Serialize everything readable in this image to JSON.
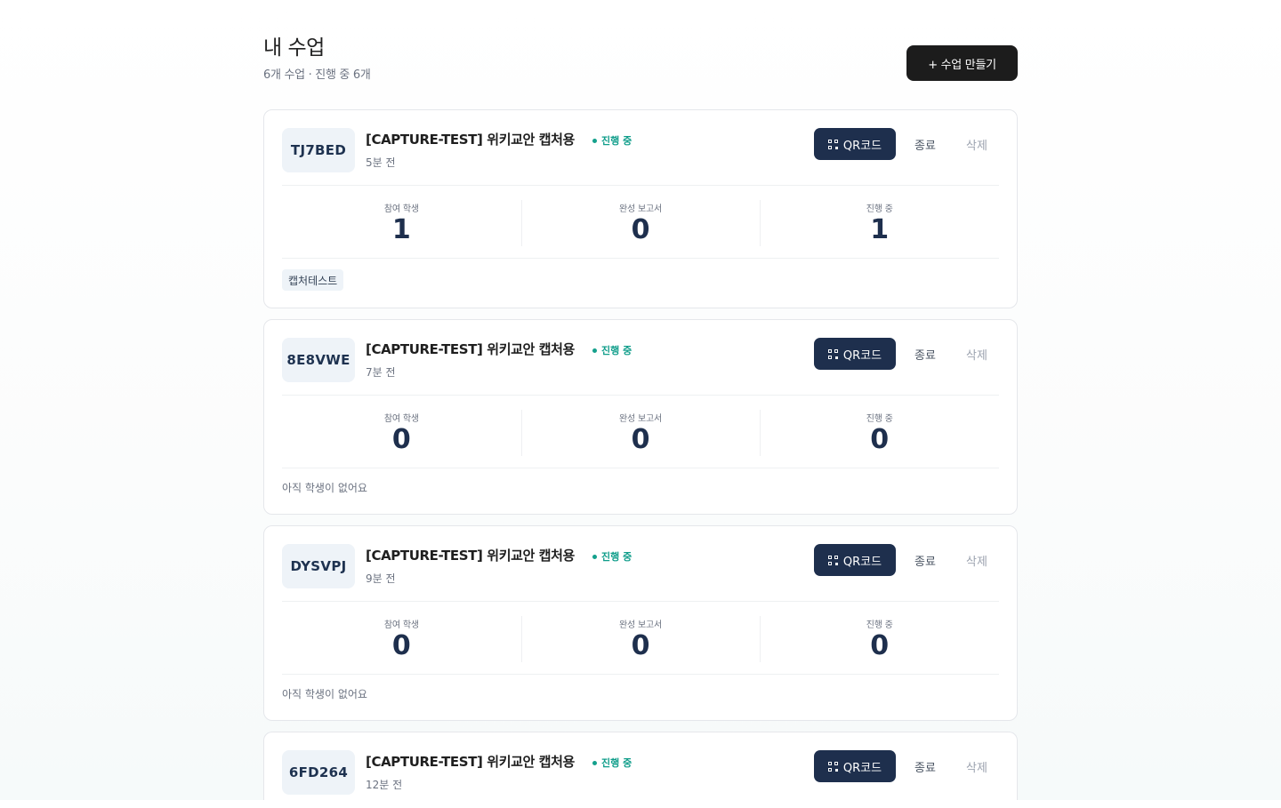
{
  "header": {
    "title": "내 수업",
    "subtitle": "6개 수업 · 진행 중 6개",
    "create_label": "+ 수업 만들기"
  },
  "classes": [
    {
      "code": "TJ7BED",
      "title": "[CAPTURE-TEST] 위키교안 캡처용",
      "status": "진행 중",
      "time": "5분 전",
      "qr_label": "QR코드",
      "end_label": "종료",
      "delete_label": "삭제",
      "stats": [
        {
          "label": "참여 학생",
          "value": "1"
        },
        {
          "label": "완성 보고서",
          "value": "0"
        },
        {
          "label": "진행 중",
          "value": "1"
        }
      ],
      "tag": "캡처테스트"
    },
    {
      "code": "8E8VWE",
      "title": "[CAPTURE-TEST] 위키교안 캡처용",
      "status": "진행 중",
      "time": "7분 전",
      "qr_label": "QR코드",
      "end_label": "종료",
      "delete_label": "삭제",
      "stats": [
        {
          "label": "참여 학생",
          "value": "0"
        },
        {
          "label": "완성 보고서",
          "value": "0"
        },
        {
          "label": "진행 중",
          "value": "0"
        }
      ],
      "empty_text": "아직 학생이 없어요"
    },
    {
      "code": "DYSVPJ",
      "title": "[CAPTURE-TEST] 위키교안 캡처용",
      "status": "진행 중",
      "time": "9분 전",
      "qr_label": "QR코드",
      "end_label": "종료",
      "delete_label": "삭제",
      "stats": [
        {
          "label": "참여 학생",
          "value": "0"
        },
        {
          "label": "완성 보고서",
          "value": "0"
        },
        {
          "label": "진행 중",
          "value": "0"
        }
      ],
      "empty_text": "아직 학생이 없어요"
    },
    {
      "code": "6FD264",
      "title": "[CAPTURE-TEST] 위키교안 캡처용",
      "status": "진행 중",
      "time": "12분 전",
      "qr_label": "QR코드",
      "end_label": "종료",
      "delete_label": "삭제"
    }
  ]
}
